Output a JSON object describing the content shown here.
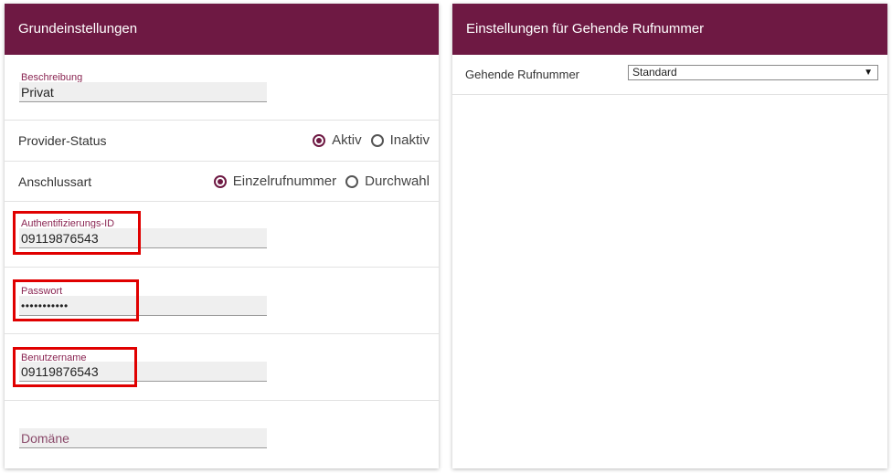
{
  "left_panel": {
    "title": "Grundeinstellungen",
    "beschreibung": {
      "label": "Beschreibung",
      "value": "Privat"
    },
    "provider_status": {
      "label": "Provider-Status",
      "options": [
        {
          "label": "Aktiv",
          "checked": true
        },
        {
          "label": "Inaktiv",
          "checked": false
        }
      ]
    },
    "anschlussart": {
      "label": "Anschlussart",
      "options": [
        {
          "label": "Einzelrufnummer",
          "checked": true
        },
        {
          "label": "Durchwahl",
          "checked": false
        }
      ]
    },
    "auth_id": {
      "label": "Authentifizierungs-ID",
      "value": "09119876543"
    },
    "passwort": {
      "label": "Passwort",
      "value": "•••••••••••"
    },
    "benutzername": {
      "label": "Benutzername",
      "value": "09119876543"
    },
    "domaene": {
      "placeholder": "Domäne"
    }
  },
  "right_panel": {
    "title": "Einstellungen für Gehende Rufnummer",
    "gehende_rufnummer": {
      "label": "Gehende Rufnummer",
      "selected": "Standard"
    }
  },
  "colors": {
    "header_bg": "#6e1943",
    "accent": "#8a2552",
    "highlight": "#e00000"
  }
}
